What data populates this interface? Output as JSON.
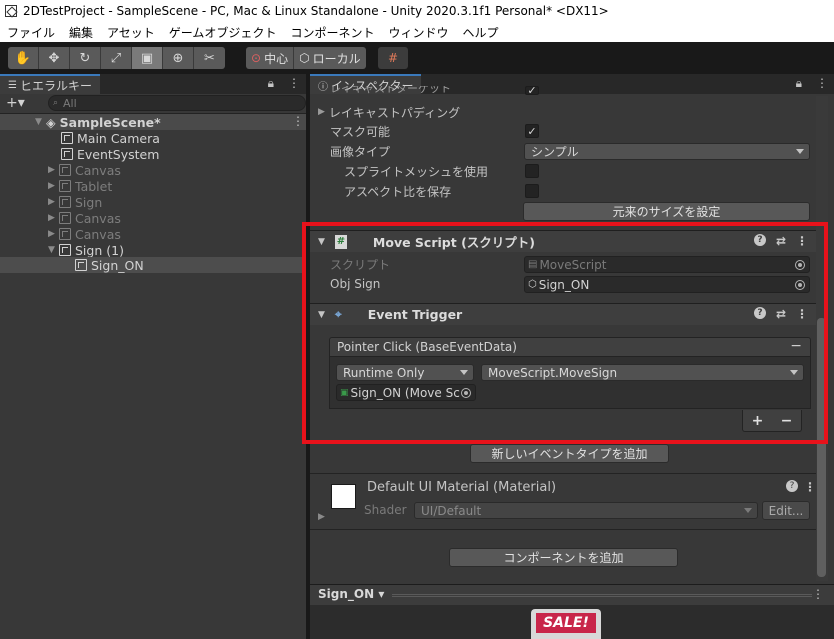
{
  "window": {
    "title": "2DTestProject - SampleScene - PC, Mac & Linux Standalone - Unity 2020.3.1f1 Personal* <DX11>"
  },
  "menu": [
    "ファイル",
    "編集",
    "アセット",
    "ゲームオブジェクト",
    "コンポーネント",
    "ウィンドウ",
    "ヘルプ"
  ],
  "toolbar": {
    "pivot_label": "中心",
    "local_label": "ローカル"
  },
  "hierarchy": {
    "tab": "ヒエラルキー",
    "search_placeholder": "All",
    "scene": "SampleScene*",
    "items": [
      {
        "label": "Main Camera",
        "dim": false
      },
      {
        "label": "EventSystem",
        "dim": false
      },
      {
        "label": "Canvas",
        "dim": true
      },
      {
        "label": "Tablet",
        "dim": true
      },
      {
        "label": "Sign",
        "dim": true
      },
      {
        "label": "Canvas",
        "dim": true
      },
      {
        "label": "Canvas",
        "dim": true
      },
      {
        "label": "Sign (1)",
        "dim": false
      },
      {
        "label": "Sign_ON",
        "dim": false
      }
    ]
  },
  "inspector": {
    "tab": "インスペクター",
    "truncated_row": "レイキャストターゲット",
    "raycast_padding": "レイキャストパディング",
    "maskable": "マスク可能",
    "image_type": "画像タイプ",
    "image_type_value": "シンプル",
    "use_sprite_mesh": "スプライトメッシュを使用",
    "preserve_aspect": "アスペクト比を保存",
    "set_native_size": "元来のサイズを設定",
    "move_script": {
      "title": "Move Script (スクリプト)",
      "script_label": "スクリプト",
      "script_value": "MoveScript",
      "obj_sign_label": "Obj Sign",
      "obj_sign_value": "Sign_ON"
    },
    "event_trigger": {
      "title": "Event Trigger",
      "entry": "Pointer Click (BaseEventData)",
      "runtime": "Runtime Only",
      "function": "MoveScript.MoveSign",
      "target": "Sign_ON (Move Sc",
      "add": "+",
      "remove": "−",
      "entry_remove": "−"
    },
    "add_event_type": "新しいイベントタイプを追加",
    "material": {
      "title": "Default UI Material (Material)",
      "shader_label": "Shader",
      "shader_value": "UI/Default",
      "edit": "Edit..."
    },
    "add_component": "コンポーネントを追加",
    "preview": {
      "name": "Sign_ON",
      "image_text": "SALE!"
    }
  },
  "colors": {
    "highlight": "#e8121b",
    "tab_accent": "#3a79bb"
  }
}
